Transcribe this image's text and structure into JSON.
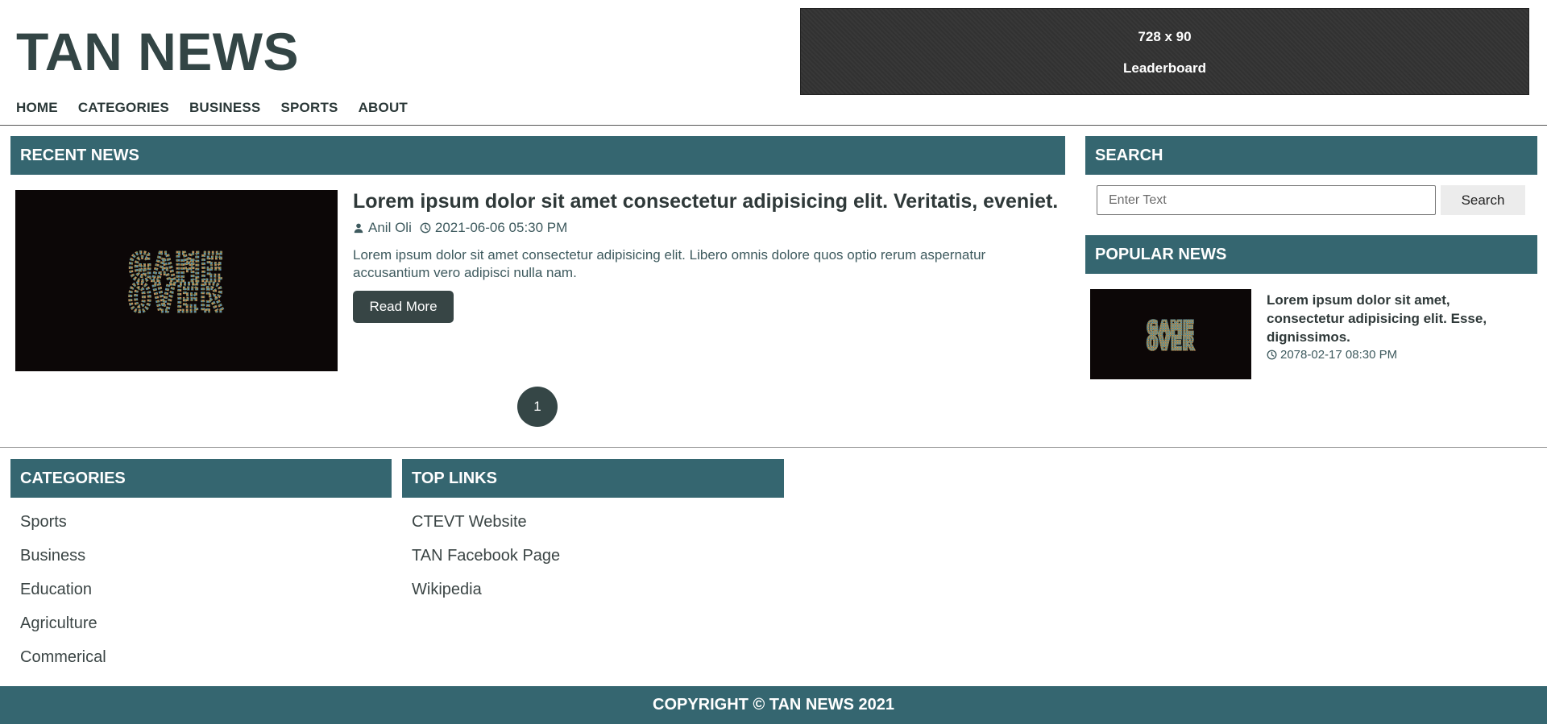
{
  "header": {
    "site_title": "TAN NEWS",
    "nav": [
      "HOME",
      "CATEGORIES",
      "BUSINESS",
      "SPORTS",
      "ABOUT"
    ],
    "ad": {
      "size": "728 x 90",
      "name": "Leaderboard"
    }
  },
  "recent": {
    "heading": "RECENT NEWS",
    "article": {
      "image_text": "GAME OVER",
      "title": "Lorem ipsum dolor sit amet consectetur adipisicing elit. Veritatis, eveniet.",
      "author": "Anil Oli",
      "date": "2021-06-06 05:30 PM",
      "excerpt": "Lorem ipsum dolor sit amet consectetur adipisicing elit. Libero omnis dolore quos optio rerum aspernatur accusantium vero adipisci nulla nam.",
      "read_more": "Read More"
    },
    "pagination": {
      "current": "1"
    }
  },
  "sidebar": {
    "search_heading": "SEARCH",
    "search_placeholder": "Enter Text",
    "search_button": "Search",
    "popular_heading": "POPULAR NEWS",
    "popular": {
      "image_text": "GAME OVER",
      "title": "Lorem ipsum dolor sit amet, consectetur adipisicing elit. Esse, dignissimos.",
      "date": "2078-02-17 08:30 PM"
    }
  },
  "footer": {
    "categories_heading": "CATEGORIES",
    "categories": [
      "Sports",
      "Business",
      "Education",
      "Agriculture",
      "Commerical"
    ],
    "links_heading": "TOP LINKS",
    "links": [
      "CTEVT Website",
      "TAN Facebook Page",
      "Wikipedia"
    ],
    "copyright": "COPYRIGHT © TAN NEWS 2021"
  },
  "colors": {
    "accent": "#356670",
    "dark_button": "#374545",
    "ad_background": "#333333"
  }
}
